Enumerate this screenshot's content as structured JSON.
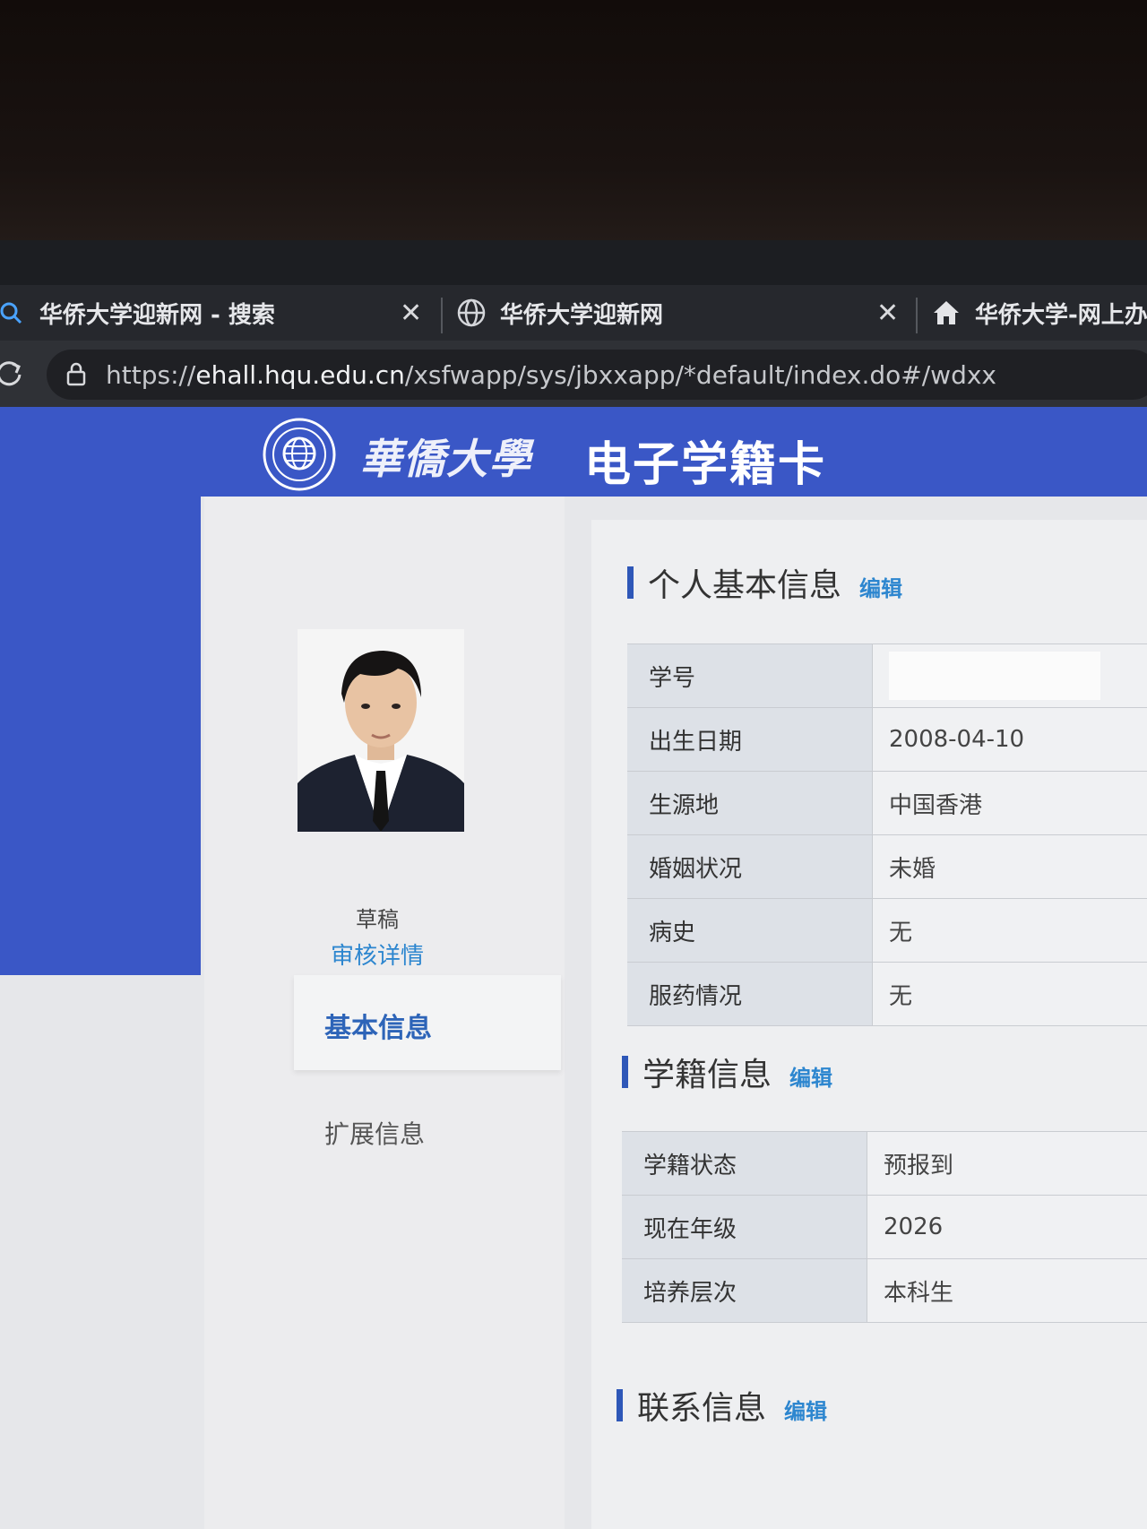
{
  "browser": {
    "tabs": [
      {
        "label": "华侨大学迎新网 - 搜索",
        "icon": "search-icon"
      },
      {
        "label": "华侨大学迎新网",
        "icon": "globe-icon"
      },
      {
        "label": "华侨大学-网上办",
        "icon": "home-icon"
      }
    ],
    "url": {
      "scheme": "https://",
      "host": "ehall.hqu.edu.cn",
      "path": "/xsfwapp/sys/jbxxapp/*default/index.do#/wdxx"
    }
  },
  "header": {
    "logo_text": "華僑大學",
    "title": "电子学籍卡",
    "accent": "#3a57c6"
  },
  "profile": {
    "photo_caption": "草稿",
    "audit_link": "审核详情"
  },
  "nav": {
    "items": [
      {
        "label": "基本信息",
        "active": true
      },
      {
        "label": "扩展信息",
        "active": false
      }
    ]
  },
  "sections": {
    "basic": {
      "title": "个人基本信息",
      "edit": "编辑",
      "rows": [
        {
          "key": "学号",
          "value": ""
        },
        {
          "key": "出生日期",
          "value": "2008-04-10"
        },
        {
          "key": "生源地",
          "value": "中国香港"
        },
        {
          "key": "婚姻状况",
          "value": "未婚"
        },
        {
          "key": "病史",
          "value": "无"
        },
        {
          "key": "服药情况",
          "value": "无"
        }
      ]
    },
    "enrollment": {
      "title": "学籍信息",
      "edit": "编辑",
      "rows": [
        {
          "key": "学籍状态",
          "value": "预报到"
        },
        {
          "key": "现在年级",
          "value": "2026"
        },
        {
          "key": "培养层次",
          "value": "本科生"
        }
      ]
    },
    "contact": {
      "title": "联系信息",
      "edit": "编辑"
    }
  }
}
